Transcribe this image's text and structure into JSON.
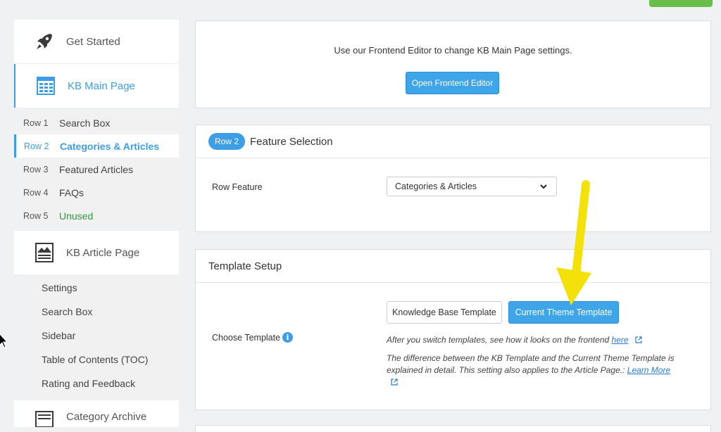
{
  "sidebar": {
    "get_started": "Get Started",
    "kb_main_page": "KB Main Page",
    "rows": [
      {
        "num": "Row 1",
        "label": "Search Box"
      },
      {
        "num": "Row 2",
        "label": "Categories & Articles"
      },
      {
        "num": "Row 3",
        "label": "Featured Articles"
      },
      {
        "num": "Row 4",
        "label": "FAQs"
      },
      {
        "num": "Row 5",
        "label": "Unused"
      }
    ],
    "kb_article_page": "KB Article Page",
    "article_items": [
      "Settings",
      "Search Box",
      "Sidebar",
      "Table of Contents (TOC)",
      "Rating and Feedback"
    ],
    "category_archive": "Category Archive"
  },
  "frontend": {
    "text": "Use our Frontend Editor to change KB Main Page settings.",
    "button": "Open Frontend Editor"
  },
  "feature_selection": {
    "pill": "Row 2",
    "title": "Feature Selection",
    "field_label": "Row Feature",
    "selected": "Categories & Articles"
  },
  "template_setup": {
    "title": "Template Setup",
    "field_label": "Choose Template",
    "option_kb": "Knowledge Base Template",
    "option_theme": "Current Theme Template",
    "help1": "After you switch templates, see how it looks on the frontend",
    "help1_link": "here",
    "help2": "The difference between the KB Template and the Current Theme Template is explained in detail. This setting also applies to the Article Page.:",
    "help2_link": "Learn More"
  },
  "colors": {
    "accent": "#3d9ee5",
    "unused": "#2e9b3e",
    "arrow": "#f5e10a"
  }
}
